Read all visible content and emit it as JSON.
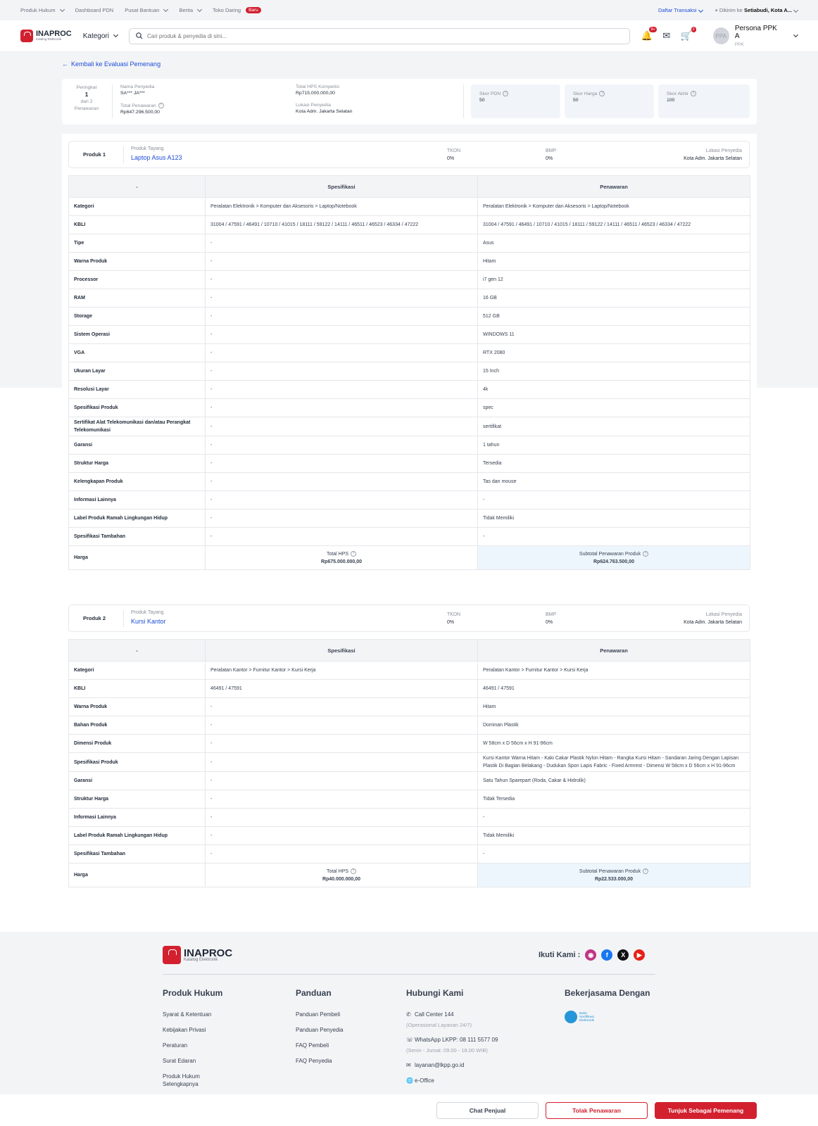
{
  "topbar": {
    "items": [
      "Produk Hukum",
      "Dashboard PDN",
      "Pusat Bantuan",
      "Berita",
      "Toko Daring"
    ],
    "baru": "Baru",
    "daftar_transaksi": "Daftar Transaksi",
    "dikirim_label": "Dikirim ke",
    "dikirim_value": "Setiabudi, Kota A..."
  },
  "header": {
    "logo": "INAPROC",
    "logo_sub": "Katalog Elektronik",
    "kategori": "Kategori",
    "search_placeholder": "Cari produk & penyedia di sini...",
    "notif_badge": "9+",
    "cart_badge": "2",
    "avatar": "PPA",
    "user_name": "Persona PPK A",
    "user_role": "PPK"
  },
  "back_link": "Kembali ke Evaluasi Pemenang",
  "summary": {
    "peringkat_label": "Peringkat",
    "peringkat": "1",
    "dari": "dari 2",
    "penawaran": "Penawaran",
    "nama_penyedia_label": "Nama Penyedia",
    "nama_penyedia": "SA*** JA***",
    "total_penawaran_label": "Total Penawaran",
    "total_penawaran": "Rp647.296.500,00",
    "total_hps_label": "Total HPS Kompetisi",
    "total_hps": "Rp715.000.000,00",
    "lokasi_label": "Lokasi Penyedia",
    "lokasi": "Kota Adm. Jakarta Selatan",
    "skor_pdn_label": "Skor PDN",
    "skor_pdn": "50",
    "skor_harga_label": "Skor Harga",
    "skor_harga": "50",
    "skor_akhir_label": "Skor Akhir",
    "skor_akhir": "100"
  },
  "labels": {
    "produk_tayang": "Produk Tayang",
    "tkdn": "TKDN",
    "bmp": "BMP",
    "lokasi_penyedia": "Lokasi Penyedia",
    "col_dash": "-",
    "col_spesifikasi": "Spesifikasi",
    "col_penawaran": "Penawaran",
    "harga": "Harga",
    "total_hps": "Total HPS",
    "subtotal": "Subtotal Penawaran Produk"
  },
  "products": [
    {
      "title": "Produk 1",
      "name": "Laptop Asus A123",
      "tkdn": "0%",
      "bmp": "0%",
      "lokasi": "Kota Adm. Jakarta Selatan",
      "rows": [
        [
          "Kategori",
          "Peralatan Elektronik > Komputer dan Aksesoris > Laptop/Notebook",
          "Peralatan Elektronik > Komputer dan Aksesoris > Laptop/Notebook"
        ],
        [
          "KBLI",
          "31004 / 47591 / 46491 / 10710 / 41015 / 18111 / 59122 / 14111 / 46511 / 46523 / 46334 / 47222",
          "31004 / 47591 / 46491 / 10710 / 41015 / 18111 / 59122 / 14111 / 46511 / 46523 / 46334 / 47222"
        ],
        [
          "Tipe",
          "-",
          "Asus"
        ],
        [
          "Warna Produk",
          "-",
          "Hitam"
        ],
        [
          "Processor",
          "-",
          "i7 gen 12"
        ],
        [
          "RAM",
          "-",
          "16 GB"
        ],
        [
          "Storage",
          "-",
          "512 GB"
        ],
        [
          "Sistem Operasi",
          "-",
          "WINDOWS 11"
        ],
        [
          "VGA",
          "-",
          "RTX 2080"
        ],
        [
          "Ukuran Layar",
          "-",
          "15 Inch"
        ],
        [
          "Resolusi Layar",
          "-",
          "4k"
        ],
        [
          "Spesifikasi Produk",
          "-",
          "spec"
        ],
        [
          "Sertifikat Alat Telekomunikasi dan/atau Perangkat Telekomunikasi",
          "-",
          "sertifikat"
        ],
        [
          "Garansi",
          "-",
          "1 tahun"
        ],
        [
          "Struktur Harga",
          "-",
          "Tersedia"
        ],
        [
          "Kelengkapan Produk",
          "-",
          "Tas dan mouse"
        ],
        [
          "Informasi Lainnya",
          "-",
          "-"
        ],
        [
          "Label Produk Ramah Lingkungan Hidup",
          "-",
          "Tidak Memiliki"
        ],
        [
          "Spesifikasi Tambahan",
          "-",
          "-"
        ]
      ],
      "total_hps": "Rp675.000.000,00",
      "subtotal": "Rp624.763.500,00"
    },
    {
      "title": "Produk 2",
      "name": "Kursi Kantor",
      "tkdn": "0%",
      "bmp": "0%",
      "lokasi": "Kota Adm. Jakarta Selatan",
      "rows": [
        [
          "Kategori",
          "Peralatan Kantor > Furnitur Kantor > Kursi Kerja",
          "Peralatan Kantor > Furnitur Kantor > Kursi Kerja"
        ],
        [
          "KBLI",
          "46491 / 47591",
          "46491 / 47591"
        ],
        [
          "Warna Produk",
          "-",
          "Hitam"
        ],
        [
          "Bahan Produk",
          "-",
          "Dominan Plastik"
        ],
        [
          "Dimensi Produk",
          "-",
          "W 58cm x D 56cm x H 91-96cm"
        ],
        [
          "Spesifikasi Produk",
          "-",
          "Kursi Kantor Warna Hitam - Kaki Cakar Plastik Nylon Hitam - Rangka Kursi Hitam - Sandaran Jaring Dengan Lapisan Plastik Di Bagian Belakang - Dudukan Spon Lapis Fabric - Fixed Armrest - Dimensi W 58cm x D 56cm x H 91-96cm"
        ],
        [
          "Garansi",
          "-",
          "Satu Tahun Sparepart (Roda, Cakar & Hidrolik)"
        ],
        [
          "Struktur Harga",
          "-",
          "Tidak Tersedia"
        ],
        [
          "Informasi Lainnya",
          "-",
          "-"
        ],
        [
          "Label Produk Ramah Lingkungan Hidup",
          "-",
          "Tidak Memiliki"
        ],
        [
          "Spesifikasi Tambahan",
          "-",
          "-"
        ]
      ],
      "total_hps": "Rp40.000.000,00",
      "subtotal": "Rp22.533.000,00"
    }
  ],
  "footer": {
    "logo": "INAPROC",
    "logo_sub": "Katalog Elektronik",
    "ikuti": "Ikuti Kami :",
    "produk_hukum": "Produk Hukum",
    "ph_items": [
      "Syarat & Ketentuan",
      "Kebijakan Privasi",
      "Peraturan",
      "Surat Edaran",
      "Produk Hukum Selengkapnya"
    ],
    "panduan": "Panduan",
    "pd_items": [
      "Panduan Pembeli",
      "Panduan Penyedia",
      "FAQ Pembeli",
      "FAQ Penyedia"
    ],
    "hubungi": "Hubungi Kami",
    "call_center": "Call Center 144",
    "cc_note": "(Operasional Layanan 24/7)",
    "whatsapp": "WhatsApp LKPP: 08 111 5577 09",
    "wa_note": "(Senin - Jumat: 09.00 - 18.00 WIB)",
    "email": "layanan@lkpp.go.id",
    "eoffice": "e-Office",
    "kerjasama": "Bekerjasama Dengan",
    "sertifikasi": "Balai Sertifikasi Elektronik"
  },
  "actions": {
    "chat": "Chat Penjual",
    "tolak": "Tolak Penawaran",
    "tunjuk": "Tunjuk Sebagai Pemenang"
  },
  "colors": {
    "brand": "#d2202f",
    "link": "#1d4ed8"
  }
}
